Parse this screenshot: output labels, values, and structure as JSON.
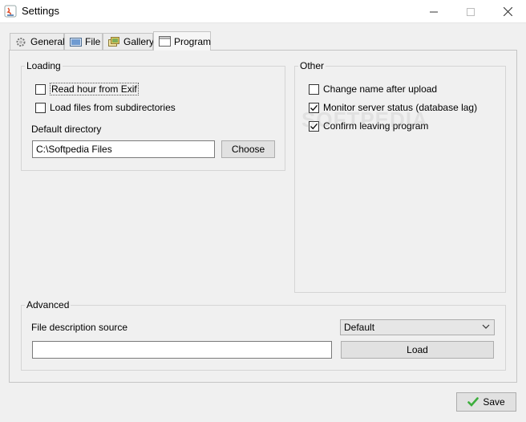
{
  "window": {
    "title": "Settings"
  },
  "tabs": [
    {
      "label": "General",
      "icon": "gear-icon"
    },
    {
      "label": "File",
      "icon": "image-icon"
    },
    {
      "label": "Gallery",
      "icon": "gallery-icon"
    },
    {
      "label": "Program",
      "icon": "window-icon"
    }
  ],
  "active_tab": "Program",
  "loading": {
    "title": "Loading",
    "read_hour_exif": {
      "label": "Read hour from Exif",
      "checked": false
    },
    "load_subdirs": {
      "label": "Load files from subdirectories",
      "checked": false
    },
    "default_dir_label": "Default directory",
    "default_dir_value": "C:\\Softpedia Files",
    "choose_label": "Choose"
  },
  "other": {
    "title": "Other",
    "change_name": {
      "label": "Change name after upload",
      "checked": false
    },
    "monitor_status": {
      "label": "Monitor server status (database lag)",
      "checked": true
    },
    "confirm_leaving": {
      "label": "Confirm leaving program",
      "checked": true
    }
  },
  "advanced": {
    "title": "Advanced",
    "desc_source_label": "File description source",
    "desc_source_value": "Default",
    "path_value": "",
    "load_label": "Load"
  },
  "footer": {
    "save_label": "Save"
  },
  "watermark": "SOFTPEDIA",
  "colors": {
    "check_accent": "#3cae3c"
  }
}
